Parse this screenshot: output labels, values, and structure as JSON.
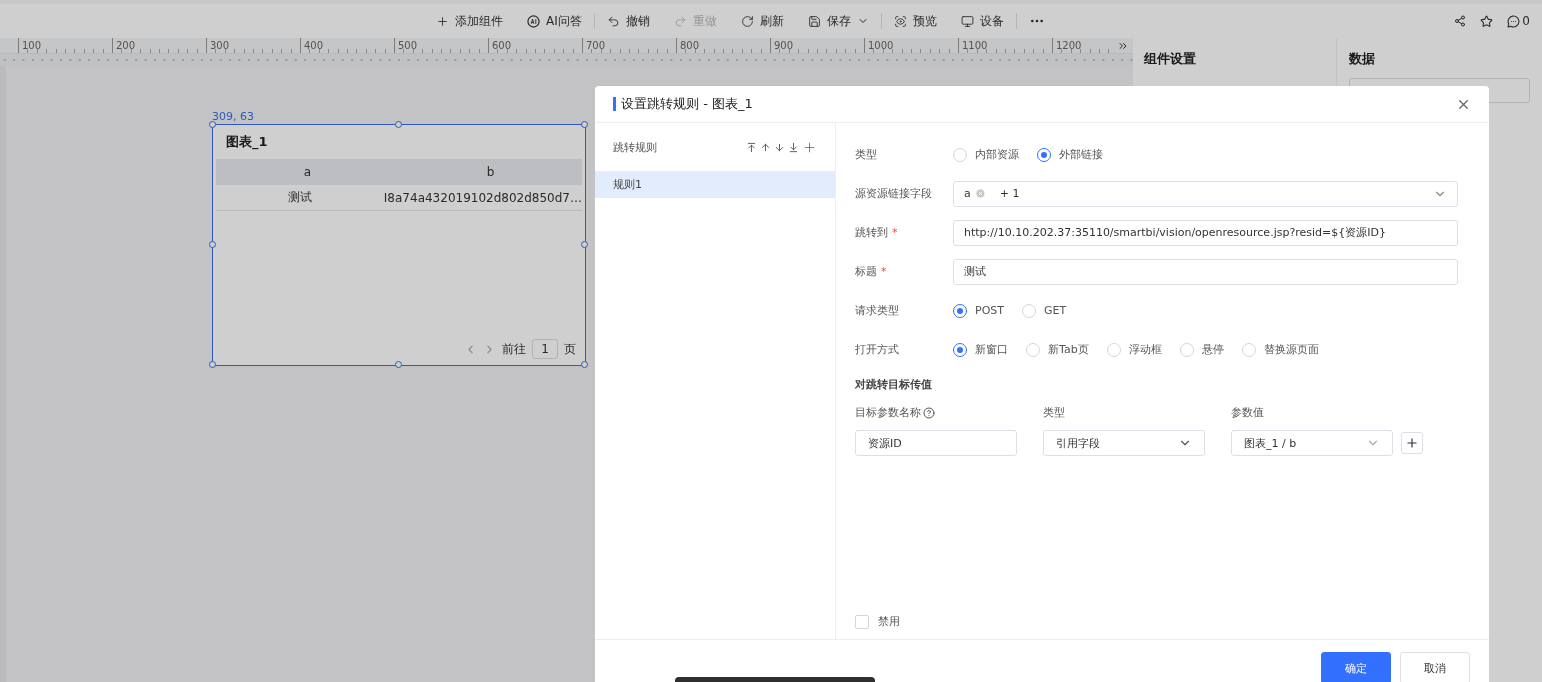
{
  "toolbar": {
    "items": [
      {
        "kind": "add",
        "label": "添加组件",
        "disabled": false
      },
      {
        "kind": "ai",
        "label": "AI问答",
        "disabled": false
      },
      {
        "kind": "undo",
        "label": "撤销",
        "disabled": false
      },
      {
        "kind": "redo",
        "label": "重做",
        "disabled": true
      },
      {
        "kind": "refresh",
        "label": "刷新",
        "disabled": false
      },
      {
        "kind": "save",
        "label": "保存",
        "disabled": false
      },
      {
        "kind": "preview",
        "label": "预览",
        "disabled": false
      },
      {
        "kind": "device",
        "label": "设备",
        "disabled": false
      },
      {
        "kind": "more",
        "disabled": false
      }
    ],
    "right": {
      "comment_count": "0"
    }
  },
  "ruler": {
    "marks": [
      "100",
      "200",
      "300",
      "400",
      "500",
      "600",
      "700",
      "800",
      "900",
      "1000",
      "1100",
      "1200"
    ]
  },
  "widget": {
    "position": "309, 63",
    "title": "图表_1",
    "columns": [
      "a",
      "b"
    ],
    "rows": [
      [
        "测试",
        "I8a74a432019102d802d850d7…"
      ]
    ],
    "pager": {
      "goto": "前往",
      "page": "1",
      "unit": "页"
    }
  },
  "side_panels": {
    "settings_title": "组件设置",
    "data_title": "数据"
  },
  "dialog": {
    "title": "设置跳转规则 - 图表_1",
    "rules": {
      "heading": "跳转规则",
      "items": [
        {
          "label": "规则1",
          "selected": true
        }
      ]
    },
    "fields": [
      {
        "kind": "radio",
        "label": "类型",
        "options": [
          {
            "label": "内部资源",
            "selected": false
          },
          {
            "label": "外部链接",
            "selected": true
          }
        ]
      },
      {
        "kind": "tags",
        "label": "源资源链接字段",
        "tags": [
          "a"
        ],
        "more": "+ 1"
      },
      {
        "kind": "input",
        "label": "跳转到",
        "required_mark": "*",
        "value": "http://10.10.202.37:35110/smartbi/vision/openresource.jsp?resid=${资源ID}"
      },
      {
        "kind": "input",
        "label": "标题",
        "required_mark": "*",
        "value": "测试"
      },
      {
        "kind": "radio",
        "label": "请求类型",
        "options": [
          {
            "label": "POST",
            "selected": true
          },
          {
            "label": "GET",
            "selected": false
          }
        ]
      },
      {
        "kind": "radio",
        "label": "打开方式",
        "options": [
          {
            "label": "新窗口",
            "selected": true
          },
          {
            "label": "新Tab页",
            "selected": false
          },
          {
            "label": "浮动框",
            "selected": false
          },
          {
            "label": "悬停",
            "selected": false
          },
          {
            "label": "替换源页面",
            "selected": false
          }
        ]
      }
    ],
    "params": {
      "section_title": "对跳转目标传值",
      "columns": [
        {
          "label": "目标参数名称",
          "help": true
        },
        {
          "label": "类型",
          "help": false
        },
        {
          "label": "参数值",
          "help": false
        }
      ],
      "rows": [
        {
          "name": "资源ID",
          "type": "引用字段",
          "value": "图表_1 / b"
        }
      ]
    },
    "disable": {
      "label": "禁用",
      "checked": false
    },
    "buttons": {
      "confirm": "确定",
      "cancel": "取消"
    }
  }
}
